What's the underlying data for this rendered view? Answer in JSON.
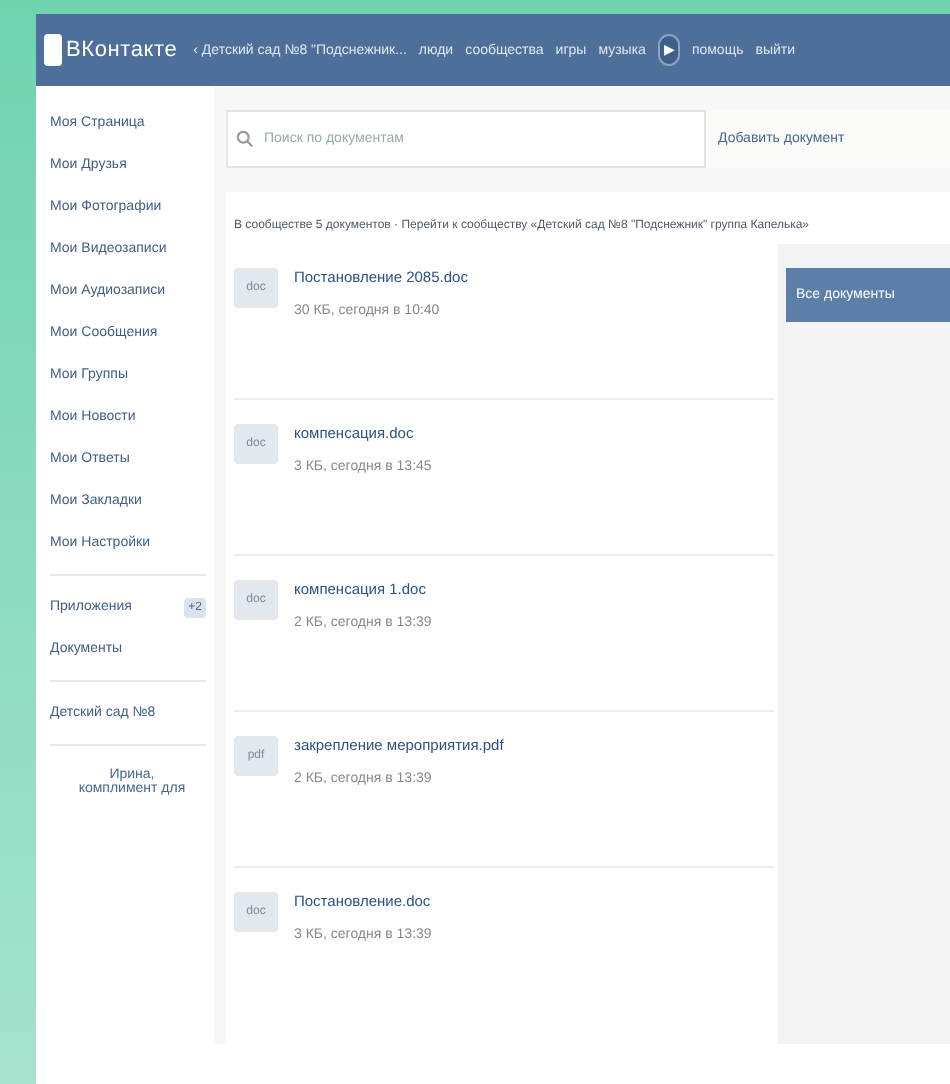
{
  "header": {
    "logo": "ВКонтакте",
    "nav": [
      {
        "label": "‹ Детский сад №8 \"Подснежник...",
        "kind": "link"
      },
      {
        "label": "люди",
        "kind": "link"
      },
      {
        "label": "сообщества",
        "kind": "link"
      },
      {
        "label": "игры",
        "kind": "link"
      },
      {
        "label": "музыка",
        "kind": "link"
      },
      {
        "label": "▶",
        "kind": "player"
      },
      {
        "label": "помощь",
        "kind": "link"
      },
      {
        "label": "выйти",
        "kind": "link"
      }
    ]
  },
  "sidebar": {
    "groups": [
      {
        "items": [
          {
            "label": "Моя Страница"
          },
          {
            "label": "Мои Друзья"
          },
          {
            "label": "Мои Фотографии"
          },
          {
            "label": "Мои Видеозаписи"
          },
          {
            "label": "Мои Аудиозаписи"
          },
          {
            "label": "Мои Сообщения"
          },
          {
            "label": "Мои Группы"
          },
          {
            "label": "Мои Новости"
          },
          {
            "label": "Мои Ответы"
          },
          {
            "label": "Мои Закладки"
          },
          {
            "label": "Мои Настройки"
          }
        ]
      },
      {
        "items": [
          {
            "label": "Приложения",
            "badge": "+2"
          },
          {
            "label": "Документы"
          }
        ]
      },
      {
        "items": [
          {
            "label": "Детский сад №8"
          }
        ]
      }
    ],
    "note": "Ирина, комплимент для"
  },
  "search": {
    "placeholder": "Поиск по документам"
  },
  "add_button": "Добавить документ",
  "summary": "В сообществе 5 документов · Перейти к сообществу «Детский сад №8 \"Подснежник\" группа Капелька»",
  "documents": [
    {
      "ext": "doc",
      "name": "Постановление 2085.doc",
      "meta": "30 КБ, сегодня в 10:40"
    },
    {
      "ext": "doc",
      "name": "компенсация.doc",
      "meta": "3 КБ, сегодня в 13:45"
    },
    {
      "ext": "doc",
      "name": "компенсация 1.doc",
      "meta": "2 КБ, сегодня в 13:39"
    },
    {
      "ext": "pdf",
      "name": "закрепление мероприятия.pdf",
      "meta": "2 КБ, сегодня в 13:39"
    },
    {
      "ext": "doc",
      "name": "Постановление.doc",
      "meta": "3 КБ, сегодня в 13:39"
    }
  ],
  "filters": [
    {
      "label": "Все документы",
      "selected": true
    }
  ]
}
